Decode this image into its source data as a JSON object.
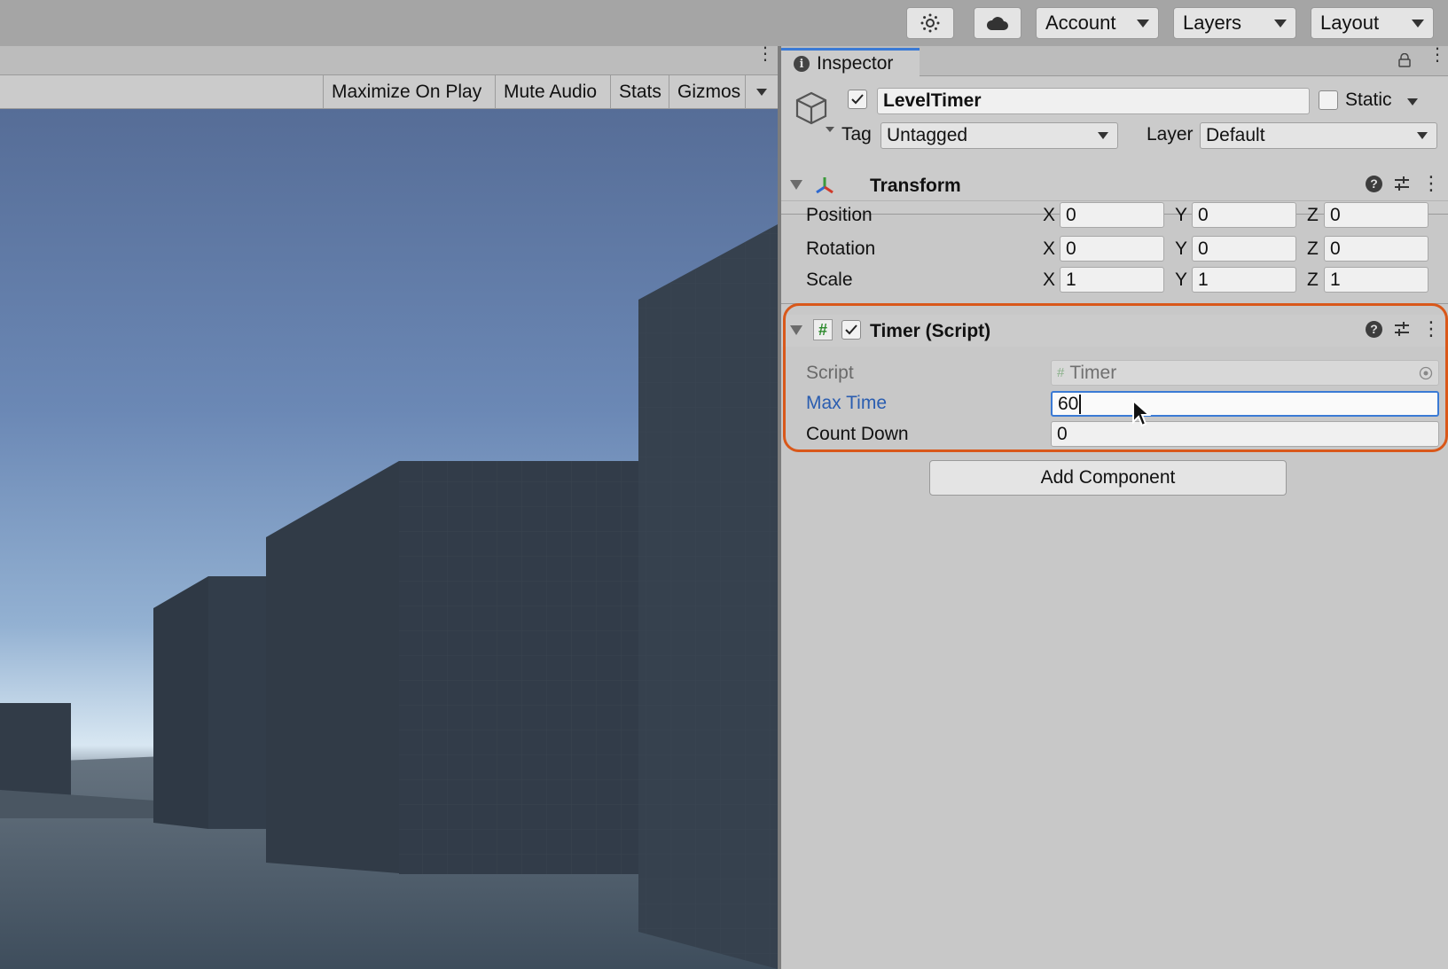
{
  "toolbar": {
    "sun_icon": "light-settings-icon",
    "cloud_icon": "cloud-icon",
    "account_label": "Account",
    "layers_label": "Layers",
    "layout_label": "Layout"
  },
  "game_view": {
    "toolbar_buttons": [
      "Maximize On Play",
      "Mute Audio",
      "Stats",
      "Gizmos"
    ]
  },
  "inspector": {
    "tab_label": "Inspector",
    "game_object": {
      "active": true,
      "name": "LevelTimer",
      "static_label": "Static",
      "static_checked": false,
      "tag_label": "Tag",
      "tag_value": "Untagged",
      "layer_label": "Layer",
      "layer_value": "Default"
    },
    "transform": {
      "title": "Transform",
      "rows": [
        {
          "label": "Position",
          "x": "0",
          "y": "0",
          "z": "0"
        },
        {
          "label": "Rotation",
          "x": "0",
          "y": "0",
          "z": "0"
        },
        {
          "label": "Scale",
          "x": "1",
          "y": "1",
          "z": "1"
        }
      ],
      "axis_labels": [
        "X",
        "Y",
        "Z"
      ]
    },
    "timer_script": {
      "title": "Timer (Script)",
      "enabled": true,
      "script_label": "Script",
      "script_value": "Timer",
      "max_time_label": "Max Time",
      "max_time_value": "60",
      "count_down_label": "Count Down",
      "count_down_value": "0"
    },
    "add_component_label": "Add Component"
  },
  "colors": {
    "accent_blue": "#3a7ad5",
    "highlight_orange": "#d9581a",
    "focused_label_blue": "#2a5db0"
  }
}
